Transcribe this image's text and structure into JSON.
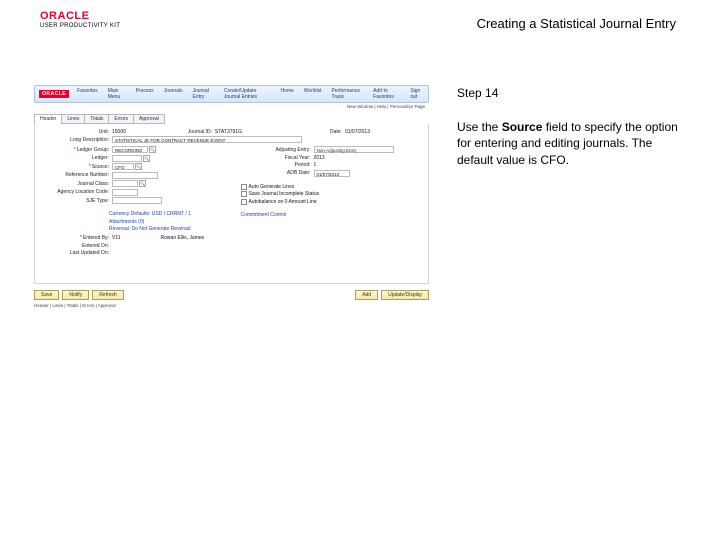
{
  "brand": {
    "name": "ORACLE",
    "sub": "USER PRODUCTIVITY KIT"
  },
  "doc_title": "Creating a Statistical Journal Entry",
  "step_label": "Step 14",
  "instruction_pre": "Use the ",
  "instruction_bold": "Source",
  "instruction_post": " field to specify the option for entering and editing journals. The default value is CFO.",
  "app": {
    "logo": "ORACLE",
    "nav": [
      "Favorites",
      "Main Menu",
      "Process",
      "Journals",
      "Journal Entry",
      "Create/Update Journal Entries"
    ],
    "nav_right": [
      "Home",
      "Worklist",
      "Performance Trace",
      "Add to Favorites",
      "Sign out"
    ],
    "userline": "New Window | Help | Personalize Page",
    "tabs": [
      "Header",
      "Lines",
      "Totals",
      "Errors",
      "Approval"
    ],
    "fields": {
      "unit_label": "Unit:",
      "unit": "15000",
      "journal_id_label": "Journal ID:",
      "journal_id": "STAT3791G",
      "date_label": "Date:",
      "date": "01/07/2013",
      "long_desc_label": "Long Description:",
      "long_desc": "STATISTICAL JE FOR CONTRACT REVENUE EVENT",
      "ledger_group_label": "Ledger Group:",
      "ledger_group": "RECORDING",
      "adj_entry_label": "Adjusting Entry:",
      "adj_entry": "Non-Adjusting Entry",
      "ledger_label": "Ledger:",
      "fy_label": "Fiscal Year:",
      "fy": "2013",
      "source_label": "Source:",
      "source": "CFO",
      "period_label": "Period:",
      "period": "1",
      "ref_label": "Reference Number:",
      "adb_label": "ADB Date:",
      "adb_date": "01/07/2013",
      "jclass_label": "Journal Class:",
      "agency_label": "Agency Location Code:",
      "autogen_label": "Auto Generate Lines",
      "save_incomplete_label": "Save Journal Incomplete Status",
      "sjetype_label": "SJE Type:",
      "autobal_label": "Autobalance on 0 Amount Line",
      "currency_defaults": "Currency Defaults: USD / CRRNT / 1",
      "attachments": "Attachments (0)",
      "reversal": "Reversal: Do Not Generate Reversal",
      "commit": "Commitment Control",
      "entered_label": "Entered By:",
      "entered_by": "V11",
      "entered_name": "Rowan Ellis, James",
      "entered_on_label": "Entered On:",
      "last_upd_label": "Last Updated On:"
    },
    "footer": {
      "save": "Save",
      "notify": "Notify",
      "refresh": "Refresh",
      "add": "Add",
      "update": "Update/Display",
      "tabs_note": "Header | Lines | Totals | Errors | Approval"
    }
  }
}
